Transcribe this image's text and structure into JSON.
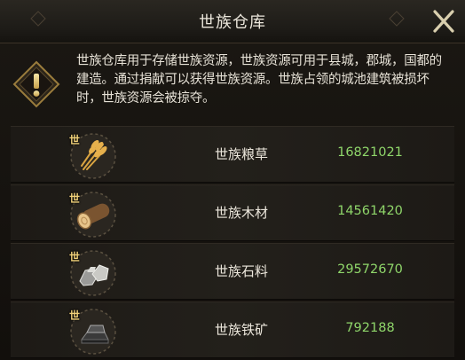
{
  "window": {
    "title": "世族仓库",
    "close_icon": "close-x-icon"
  },
  "notice": {
    "icon": "warning-exclamation-icon",
    "text": "世族仓库用于存储世族资源，世族资源可用于县城，郡城，国都的建造。通过捐献可以获得世族资源。世族占领的城池建筑被损坏时，世族资源会被掠夺。"
  },
  "resources": [
    {
      "badge": "世",
      "icon": "wheat-grain-icon",
      "name": "世族粮草",
      "value": "16821021"
    },
    {
      "badge": "世",
      "icon": "wood-log-icon",
      "name": "世族木材",
      "value": "14561420"
    },
    {
      "badge": "世",
      "icon": "stone-ore-icon",
      "name": "世族石料",
      "value": "29572670"
    },
    {
      "badge": "世",
      "icon": "iron-ingot-icon",
      "name": "世族铁矿",
      "value": "792188"
    }
  ],
  "colors": {
    "value_green": "#8fd66a",
    "text_light": "#ece7dc",
    "badge_gold": "#f2d27a",
    "panel_bg": "#14110e"
  }
}
